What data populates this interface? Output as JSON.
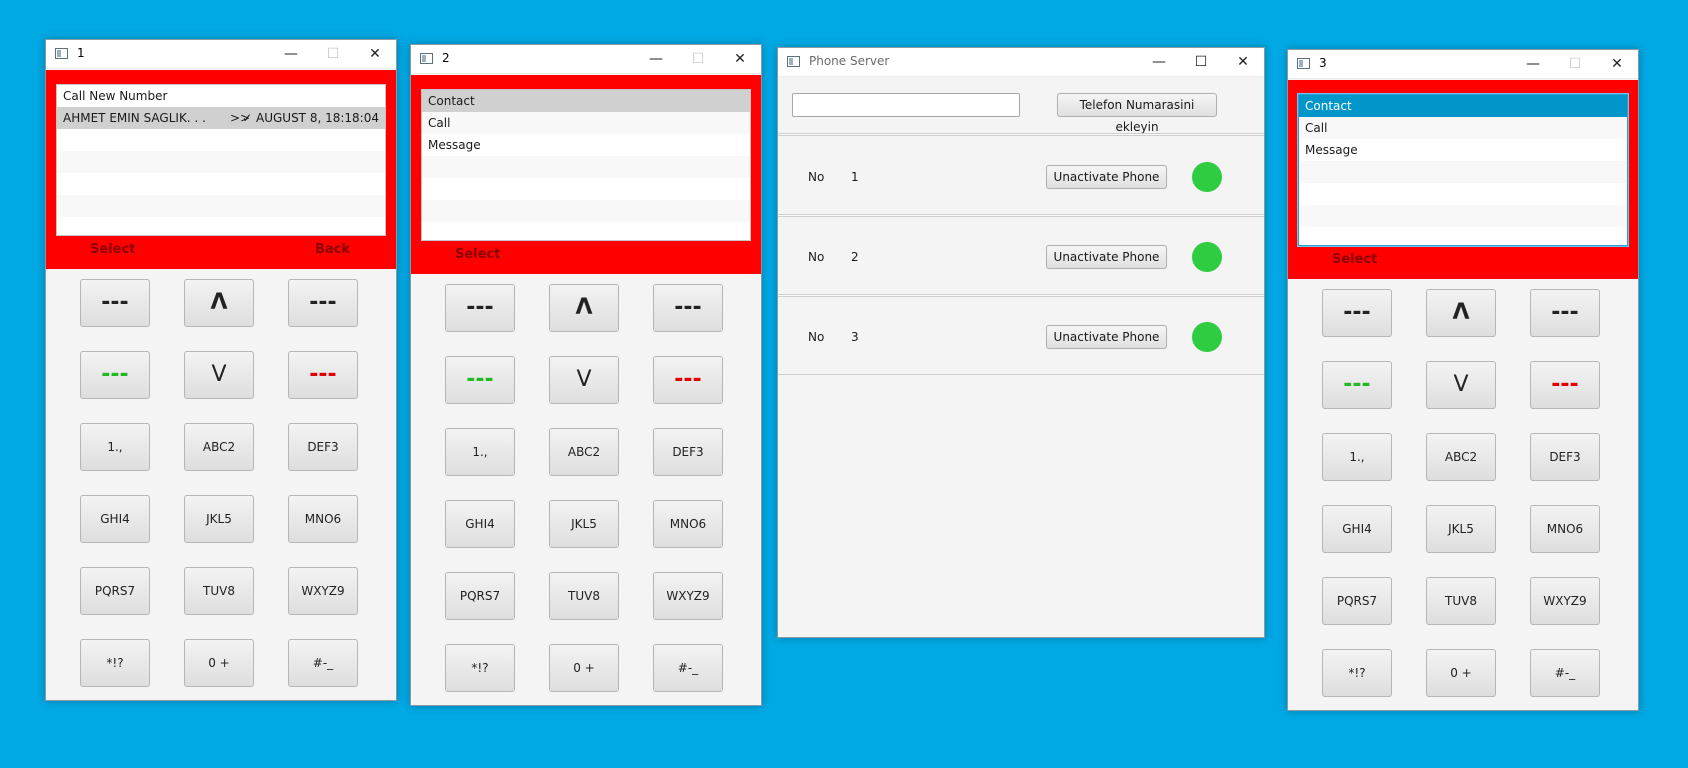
{
  "windows": [
    {
      "title": "1",
      "list": [
        {
          "text": "Call New Number"
        },
        {
          "text": "AHMET EMIN SAGLIK. . .",
          "arrow": ">>",
          "date": "✓ AUGUST 8, 18:18:04"
        }
      ],
      "softkeys": {
        "left": "Select",
        "right": "Back"
      }
    },
    {
      "title": "2",
      "list": [
        {
          "text": "Contact"
        },
        {
          "text": "Call"
        },
        {
          "text": "Message"
        }
      ],
      "softkeys": {
        "left": "Select"
      }
    },
    {
      "title": "3",
      "list": [
        {
          "text": "Contact"
        },
        {
          "text": "Call"
        },
        {
          "text": "Message"
        }
      ],
      "softkeys": {
        "left": "Select"
      }
    }
  ],
  "keypad": {
    "nav": [
      "---",
      "Λ",
      "---",
      "---",
      "V",
      "---"
    ],
    "keys": [
      "1.,",
      "ABC2",
      "DEF3",
      "GHI4",
      "JKL5",
      "MNO6",
      "PQRS7",
      "TUV8",
      "WXYZ9",
      "*!?",
      "0 +",
      "#-_"
    ]
  },
  "titlebar": {
    "minimize": "—",
    "maximize": "☐",
    "close": "✕"
  },
  "server": {
    "title": "Phone Server",
    "input_value": "",
    "add_button": "Telefon Numarasini ekleyin",
    "rows": [
      {
        "label": "No",
        "number": "1",
        "button": "Unactivate Phone",
        "status": "active"
      },
      {
        "label": "No",
        "number": "2",
        "button": "Unactivate Phone",
        "status": "active"
      },
      {
        "label": "No",
        "number": "3",
        "button": "Unactivate Phone",
        "status": "active"
      }
    ]
  },
  "colors": {
    "background": "#00a8e4",
    "panel": "#ff0000",
    "status_active": "#2ecc40",
    "key_green": "#25b825",
    "key_red": "#e00000"
  }
}
